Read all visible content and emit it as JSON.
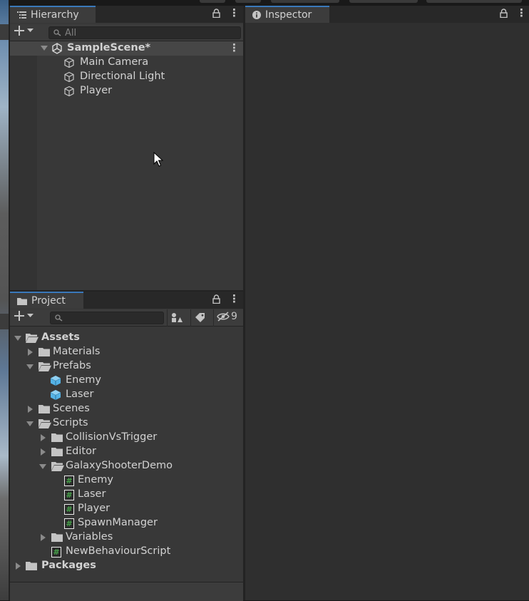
{
  "hierarchy": {
    "tab_label": "Hierarchy",
    "search_placeholder": "All",
    "scene": {
      "name": "SampleScene*"
    },
    "items": [
      {
        "label": "Main Camera"
      },
      {
        "label": "Directional Light"
      },
      {
        "label": "Player"
      }
    ]
  },
  "inspector": {
    "tab_label": "Inspector"
  },
  "project": {
    "tab_label": "Project",
    "hidden_count": "9",
    "tree": {
      "assets": "Assets",
      "materials": "Materials",
      "prefabs": "Prefabs",
      "enemy_prefab": "Enemy",
      "laser_prefab": "Laser",
      "scenes": "Scenes",
      "scripts": "Scripts",
      "collision": "CollisionVsTrigger",
      "editor": "Editor",
      "galaxy": "GalaxyShooterDemo",
      "enemy_script": "Enemy",
      "laser_script": "Laser",
      "player_script": "Player",
      "spawn_script": "SpawnManager",
      "variables": "Variables",
      "new_behaviour": "NewBehaviourScript",
      "packages": "Packages"
    }
  },
  "colors": {
    "panel_bg": "#383838",
    "inspector_bg": "#2f2f2f",
    "tab_accent": "#3a79bb",
    "prefab_blue": "#55b3e6",
    "script_green": "#47a34a"
  }
}
